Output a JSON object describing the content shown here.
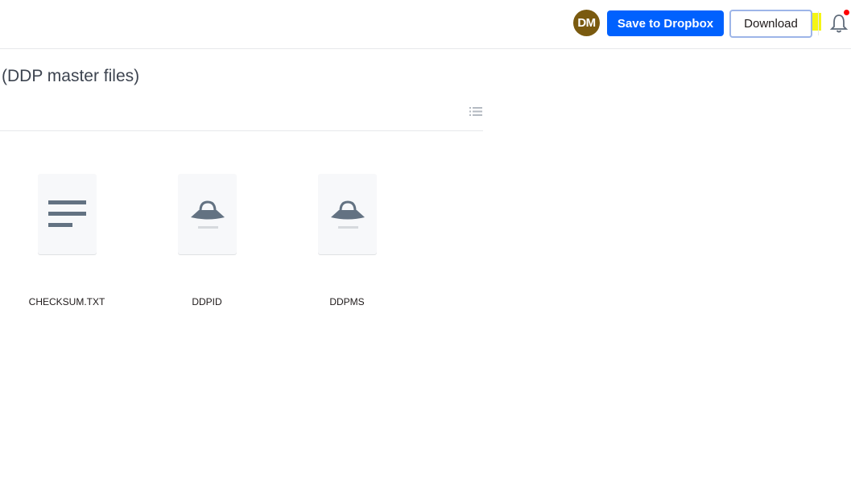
{
  "header": {
    "avatar_initials": "DM",
    "save_button": "Save to Dropbox",
    "download_button": "Download",
    "notifications_icon": "bell-icon",
    "colors": {
      "save_bg": "#0061fe",
      "avatar_bg": "#7a5a0f",
      "highlight": "#f4f40a",
      "notification_dot": "#ff0000"
    }
  },
  "folder": {
    "title": "(DDP master files)",
    "view_toggle_icon": "list-view-icon"
  },
  "files": [
    {
      "name": "CHECKSUM.TXT",
      "icon": "text-file-icon"
    },
    {
      "name": "DDPID",
      "icon": "generic-file-icon"
    },
    {
      "name": "DDPMS",
      "icon": "generic-file-icon"
    }
  ]
}
